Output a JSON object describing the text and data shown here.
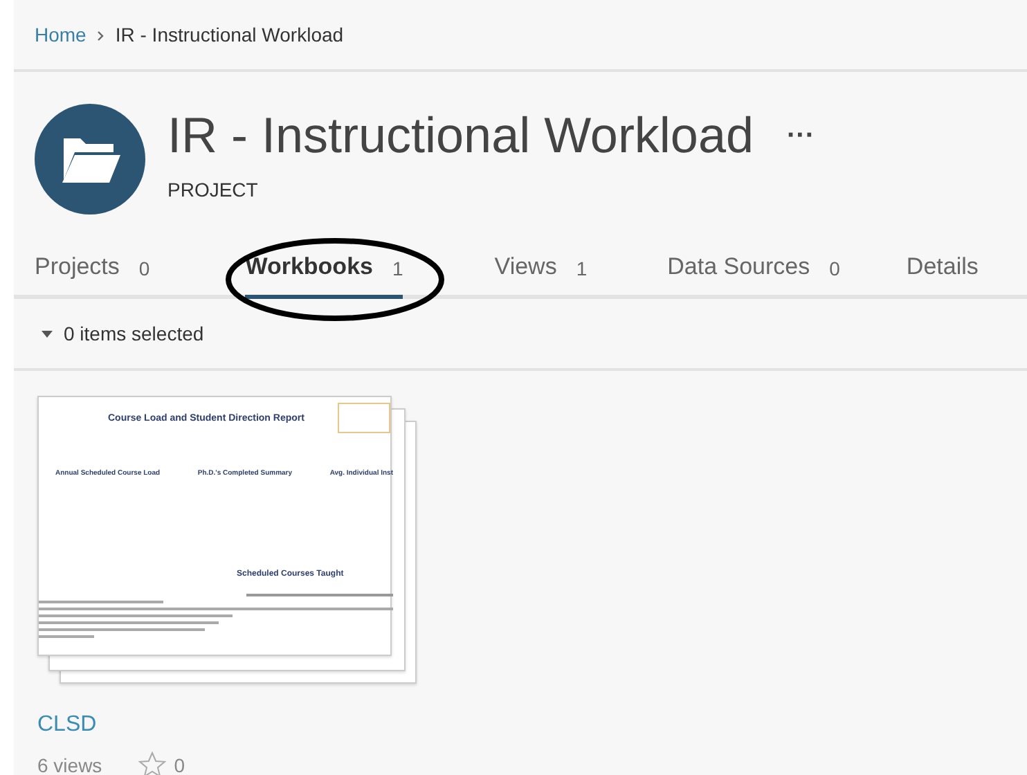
{
  "breadcrumb": [
    {
      "label": "Home",
      "link": true
    },
    {
      "label": "IR - Instructional Workload",
      "link": false
    }
  ],
  "header": {
    "title": "IR - Instructional Workload",
    "more": "···",
    "type": "PROJECT"
  },
  "tabs": [
    {
      "label": "Projects",
      "count": "0",
      "selected": false
    },
    {
      "label": "Workbooks",
      "count": "1",
      "selected": true
    },
    {
      "label": "Views",
      "count": "1",
      "selected": false
    },
    {
      "label": "Data Sources",
      "count": "0",
      "selected": false
    },
    {
      "label": "Details",
      "selected": false
    }
  ],
  "selection": {
    "label": "0 items selected"
  },
  "workbooks": [
    {
      "name": "CLSD",
      "views": "6 views",
      "favorites": "0",
      "thumbnail": {
        "title": "Course Load and Student Direction Report",
        "sections": [
          "Annual Scheduled Course Load",
          "Ph.D.'s Completed Summary",
          "Avg. Individual Inst"
        ],
        "subtitle": "Scheduled Courses Taught"
      }
    }
  ]
}
